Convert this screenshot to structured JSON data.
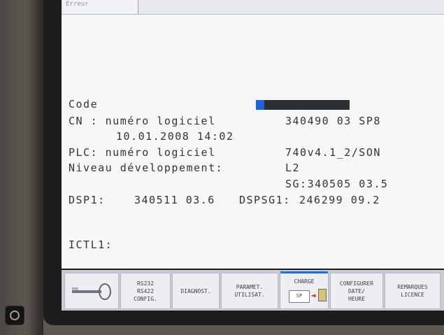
{
  "window": {
    "tab_label": "Erreur"
  },
  "content": {
    "code_label": "Code",
    "cn_line_label": "CN : numéro logiciel",
    "cn_line_value": "340490 03 SP8",
    "cn_date": "10.01.2008 14:02",
    "plc_label": "PLC: numéro logiciel",
    "plc_value": "740v4.1_2/SON",
    "niveau_label": "Niveau développement:",
    "niveau_value": "L2",
    "sg_value": "SG:340505 03.5",
    "dsp1_label": "DSP1:",
    "dsp1_value": "340511 03.6",
    "dspsg1_label": "DSPSG1:",
    "dspsg1_value": "246299 09.2",
    "ictl1_label": "ICTL1:"
  },
  "softkeys": {
    "pm_label": "PM",
    "rs232": "RS232\nRS422\nCONFIG.",
    "diagnost": "DIAGNOST.",
    "parametres": "PARAMET.\nUTILISAT.",
    "charge": "CHARGE",
    "charge_sp": "SP",
    "configurer": "CONFIGURER\nDATE/\nHEURE",
    "remarques": "REMARQUES\nLICENCE"
  }
}
